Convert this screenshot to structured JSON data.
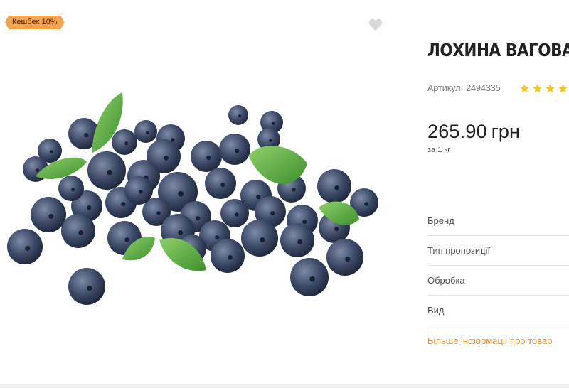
{
  "badge": {
    "cashback": "Кешбек 10%"
  },
  "product": {
    "title": "ЛОХИНА ВАГОВА",
    "sku_label": "Артикул:",
    "sku_value": "2494335",
    "rating": 4,
    "price_value": "265.90",
    "currency": "грн",
    "unit": "за 1 кг"
  },
  "attributes": [
    {
      "label": "Бренд"
    },
    {
      "label": "Тип пропозиції"
    },
    {
      "label": "Обробка"
    },
    {
      "label": "Вид"
    }
  ],
  "more_info_link": "Більше інформації про товар",
  "icons": {
    "wishlist": "heart-icon",
    "rating": "star-icon"
  },
  "colors": {
    "accent": "#e98c2e",
    "badge_bg": "#f4a44e",
    "star": "#f5c51c",
    "heart": "#d9d9d9"
  }
}
